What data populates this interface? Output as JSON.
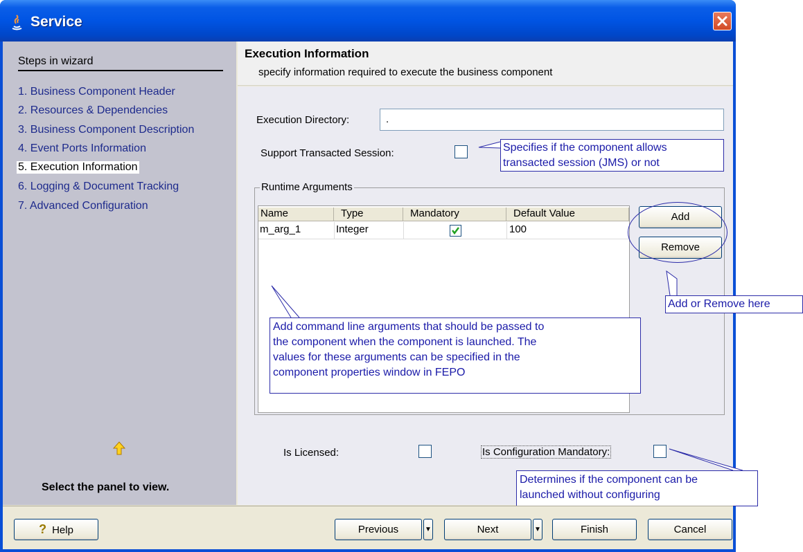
{
  "window": {
    "title": "Service"
  },
  "steps": {
    "title": "Steps in wizard",
    "items": [
      "1. Business Component Header",
      "2. Resources & Dependencies",
      "3. Business Component Description",
      "4. Event Ports Information",
      "5. Execution Information",
      "6. Logging & Document Tracking",
      "7. Advanced Configuration"
    ],
    "hint": "Select the panel to view."
  },
  "panel": {
    "title": "Execution Information",
    "subtitle": "specify information required to execute the business component"
  },
  "form": {
    "exec_dir_label": "Execution Directory:",
    "exec_dir_value": ".",
    "transacted_label": "Support Transacted Session:",
    "licensed_label": "Is Licensed:",
    "config_mandatory_label": "Is Configuration Mandatory:"
  },
  "runtime": {
    "group_label": "Runtime Arguments",
    "columns": [
      "Name",
      "Type",
      "Mandatory",
      "Default Value"
    ],
    "rows": [
      {
        "name": "m_arg_1",
        "type": "Integer",
        "mandatory": true,
        "default": "100"
      }
    ],
    "add_label": "Add",
    "remove_label": "Remove"
  },
  "callouts": {
    "transacted": [
      "Specifies if the component allows",
      "transacted session (JMS) or not"
    ],
    "add_remove": "Add or Remove here",
    "args": [
      "Add command line arguments that should be passed to",
      "the component when the component is launched. The",
      "values for these arguments can be specified in the",
      "component properties window in FEPO"
    ],
    "config": [
      "Determines if the component can be",
      "launched without configuring"
    ]
  },
  "footer": {
    "help": "Help",
    "previous": "Previous",
    "next": "Next",
    "finish": "Finish",
    "cancel": "Cancel"
  },
  "colors": {
    "titlebar": "#0054e3",
    "steps_bg": "#c3c3cf",
    "callout_text": "#1a1aa8",
    "check_green": "#21a121"
  }
}
